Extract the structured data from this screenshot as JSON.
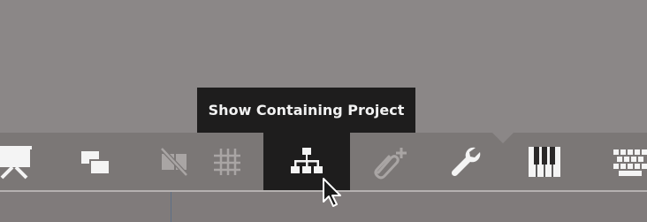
{
  "tooltip": {
    "text": "Show Containing Project"
  },
  "toolbar": {
    "buttons": [
      {
        "name": "presentation-icon",
        "state": "normal"
      },
      {
        "name": "overlapping-windows-icon",
        "state": "normal"
      },
      {
        "name": "hide-icon",
        "state": "disabled"
      },
      {
        "name": "grid-icon",
        "state": "disabled"
      },
      {
        "name": "hierarchy-icon",
        "state": "active"
      },
      {
        "name": "attach-add-icon",
        "state": "disabled"
      },
      {
        "name": "wrench-icon",
        "state": "normal"
      },
      {
        "name": "piano-keys-icon",
        "state": "normal"
      },
      {
        "name": "keyboard-icon",
        "state": "normal"
      }
    ]
  },
  "colors": {
    "background": "#8b8787",
    "toolbar": "#7b7776",
    "tooltip_bg": "#1e1d1d",
    "tooltip_text": "#f2f2f2",
    "icon_normal": "#f4f4f4",
    "icon_disabled": "#a9a5a4"
  }
}
